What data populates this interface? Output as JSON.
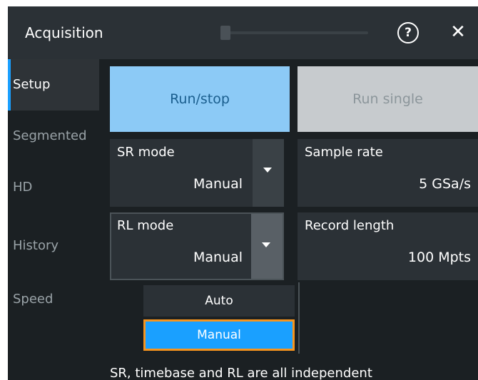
{
  "header": {
    "title": "Acquisition",
    "help_icon": "?",
    "close_icon": "✕"
  },
  "sidebar": {
    "items": [
      {
        "label": "Setup",
        "active": true
      },
      {
        "label": "Segmented",
        "active": false
      },
      {
        "label": "HD",
        "active": false
      },
      {
        "label": "History",
        "active": false
      },
      {
        "label": "Speed",
        "active": false
      }
    ]
  },
  "buttons": {
    "run_stop": "Run/stop",
    "run_single": "Run single"
  },
  "fields": {
    "sr_mode": {
      "label": "SR mode",
      "value": "Manual"
    },
    "sample_rate": {
      "label": "Sample rate",
      "value": "5 GSa/s"
    },
    "rl_mode": {
      "label": "RL mode",
      "value": "Manual"
    },
    "record_length": {
      "label": "Record length",
      "value": "100 Mpts"
    }
  },
  "dropdown": {
    "options": [
      "Auto",
      "Manual"
    ],
    "selected": "Manual"
  },
  "status": "SR, timebase and RL are all independent",
  "colors": {
    "accent": "#1aa0ff",
    "focus": "#f7941d",
    "run_button": "#8ccaf6"
  }
}
